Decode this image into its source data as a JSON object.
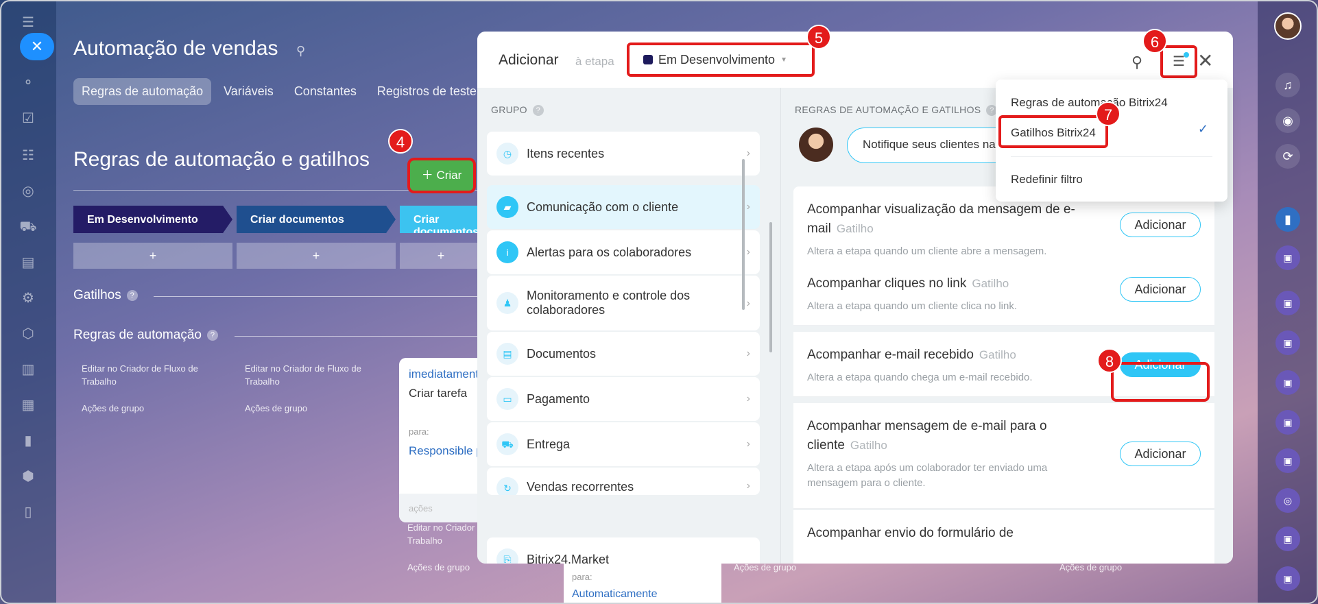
{
  "background": {
    "title": "Automação de vendas",
    "tabs": [
      "Regras de automação",
      "Variáveis",
      "Constantes",
      "Registros de teste"
    ],
    "section_title": "Regras de automação e gatilhos",
    "create_label": "Criar",
    "stages": [
      {
        "label": "Em Desenvolvimento",
        "color": "#241c66"
      },
      {
        "label": "Criar documentos",
        "color": "#1f4f8f"
      },
      {
        "label": "Criar documentos",
        "color": "#3cc3f0"
      }
    ],
    "plus": "+",
    "triggers_label": "Gatilhos",
    "rules_label": "Regras de automação",
    "edit_flow": "Editar no Criador de Fluxo de Trabalho",
    "group_actions": "Ações de grupo",
    "card": {
      "link": "imediatamente",
      "task": "Criar tarefa",
      "for": "para:",
      "responsible": "Responsible person",
      "actions": "ações"
    },
    "card2": {
      "for": "para:",
      "auto": "Automaticamente"
    }
  },
  "modal": {
    "title": "Adicionar",
    "subtitle": "à etapa",
    "stage_selected": "Em Desenvolvimento",
    "group_header": "GRUPO",
    "groups": [
      {
        "label": "Itens recentes",
        "icon": "clock-icon"
      },
      {
        "label": "Comunicação com o cliente",
        "icon": "chat-icon",
        "selected": true
      },
      {
        "label": "Alertas para os colaboradores",
        "icon": "info-icon"
      },
      {
        "label": "Monitoramento e controle dos colaboradores",
        "icon": "users-icon"
      },
      {
        "label": "Documentos",
        "icon": "document-icon"
      },
      {
        "label": "Pagamento",
        "icon": "wallet-icon"
      },
      {
        "label": "Entrega",
        "icon": "truck-icon"
      },
      {
        "label": "Vendas recorrentes",
        "icon": "repeat-icon"
      }
    ],
    "market_label": "Bitrix24.Market",
    "rules_header": "REGRAS DE AUTOMAÇÃO E GATILHOS",
    "bubble_text": "Notifique seus clientes na",
    "triggers": [
      {
        "name": "Acompanhar visualização da mensagem de e-mail",
        "kind": "Gatilho",
        "desc": "Altera a etapa quando um cliente abre a mensagem.",
        "button": "Adicionar"
      },
      {
        "name": "Acompanhar cliques no link",
        "kind": "Gatilho",
        "desc": "Altera a etapa quando um cliente clica no link.",
        "button": "Adicionar"
      },
      {
        "name": "Acompanhar e-mail recebido",
        "kind": "Gatilho",
        "desc": "Altera a etapa quando chega um e-mail recebido.",
        "button": "Adicionar"
      },
      {
        "name": "Acompanhar mensagem de e-mail para o cliente",
        "kind": "Gatilho",
        "desc": "Altera a etapa após um colaborador ter enviado uma mensagem para o cliente.",
        "button": "Adicionar"
      },
      {
        "name": "Acompanhar envio do formulário de",
        "kind": "",
        "desc": "",
        "button": ""
      }
    ]
  },
  "dropdown": {
    "items": [
      "Regras de automação Bitrix24",
      "Gatilhos Bitrix24",
      "Redefinir filtro"
    ]
  },
  "badges": [
    "4",
    "5",
    "6",
    "7",
    "8"
  ],
  "colors": {
    "accent": "#2fc6f6",
    "highlight": "#e31b1b",
    "create_green": "#4cae4c"
  }
}
